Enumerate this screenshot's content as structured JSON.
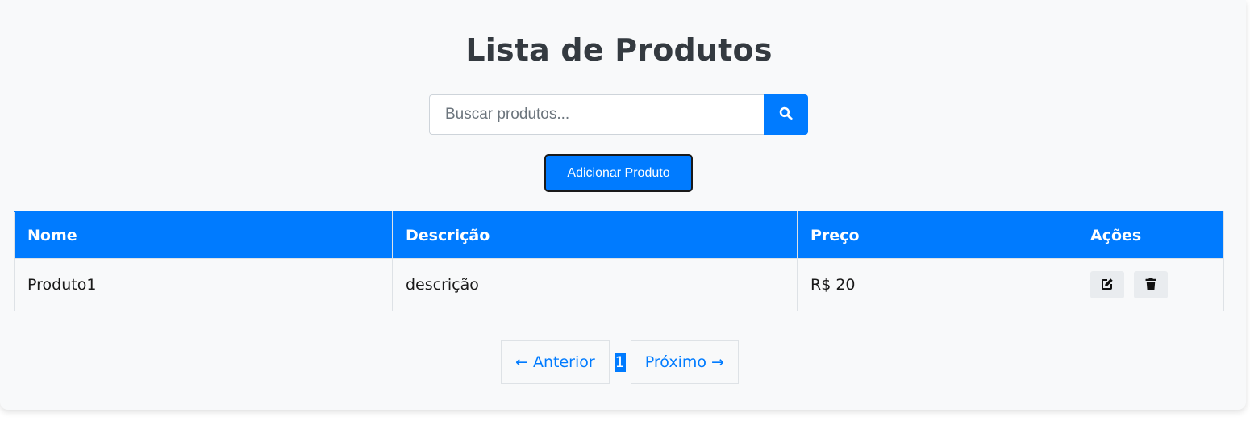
{
  "header": {
    "title": "Lista de Produtos"
  },
  "search": {
    "placeholder": "Buscar produtos...",
    "value": "",
    "button_icon": "search-icon"
  },
  "toolbar": {
    "add_label": "Adicionar Produto"
  },
  "table": {
    "columns": [
      "Nome",
      "Descrição",
      "Preço",
      "Ações"
    ],
    "rows": [
      {
        "nome": "Produto1",
        "descricao": "descrição",
        "preco": "R$ 20",
        "actions": [
          "edit-icon",
          "trash-icon"
        ]
      }
    ]
  },
  "pagination": {
    "prev_label": "← Anterior",
    "current_page": "1",
    "next_label": "Próximo →"
  },
  "colors": {
    "accent": "#007bff",
    "background": "#f8f9fa",
    "title": "#343a40"
  }
}
